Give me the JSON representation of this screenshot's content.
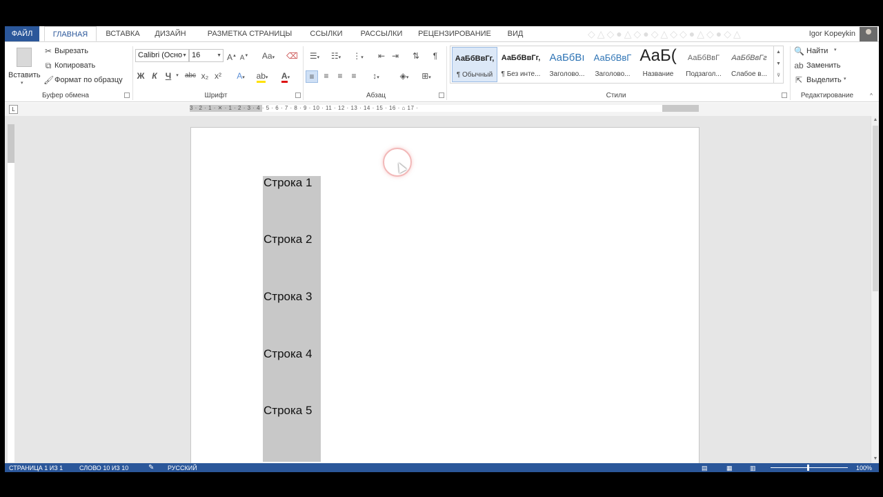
{
  "tabs": [
    "ФАЙЛ",
    "ГЛАВНАЯ",
    "ВСТАВКА",
    "ДИЗАЙН",
    "РАЗМЕТКА СТРАНИЦЫ",
    "ССЫЛКИ",
    "РАССЫЛКИ",
    "РЕЦЕНЗИРОВАНИЕ",
    "ВИД"
  ],
  "user": {
    "name": "Igor Kopeykin"
  },
  "clipboard": {
    "paste_label": "Вставить",
    "cut_label": "Вырезать",
    "copy_label": "Копировать",
    "format_painter_label": "Формат по образцу",
    "group_label": "Буфер обмена"
  },
  "font": {
    "family": "Calibri (Осно",
    "size": "16",
    "case_label": "Aa",
    "bold": "Ж",
    "italic": "К",
    "underline": "Ч",
    "strike": "abc",
    "subscript": "x₂",
    "superscript": "x²",
    "group_label": "Шрифт"
  },
  "paragraph": {
    "group_label": "Абзац"
  },
  "styles": {
    "items": [
      {
        "preview": "АаБбВвГг,",
        "name": "¶ Обычный"
      },
      {
        "preview": "АаБбВвГг,",
        "name": "¶ Без инте..."
      },
      {
        "preview": "АаБбВı",
        "name": "Заголово..."
      },
      {
        "preview": "АаБбВвГ",
        "name": "Заголово..."
      },
      {
        "preview": "АаБ(",
        "name": "Название"
      },
      {
        "preview": "АаБбВвГ",
        "name": "Подзагол..."
      },
      {
        "preview": "АаБбВвГг",
        "name": "Слабое в..."
      }
    ],
    "group_label": "Стили"
  },
  "editing": {
    "find_label": "Найти",
    "replace_label": "Заменить",
    "select_label": "Выделить",
    "group_label": "Редактирование"
  },
  "ruler": {
    "corner": "L",
    "numbers": "3 · 2 · 1 · ✕ · 1 · 2 · 3 · 4 · 5 · 6 · 7 · 8 · 9 · 10 · 11 · 12 · 13 · 14 · 15 · 16 · ⌂ 17 ·"
  },
  "document": {
    "rows": [
      "Строка 1",
      "Строка 2",
      "Строка 3",
      "Строка 4",
      "Строка 5"
    ]
  },
  "status": {
    "page": "СТРАНИЦА 1 ИЗ 1",
    "words": "СЛОВО 10 ИЗ 10",
    "language": "РУССКИЙ",
    "zoom": "100%"
  },
  "colors": {
    "accent": "#2b579a",
    "column_fill": "#c8c8c8"
  }
}
